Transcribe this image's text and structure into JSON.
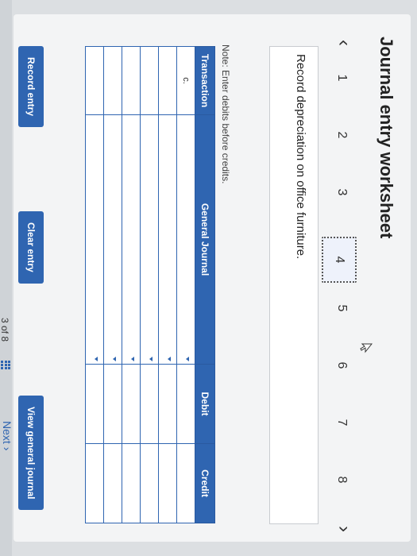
{
  "title": "Journal entry worksheet",
  "steps": [
    "1",
    "2",
    "3",
    "4",
    "5",
    "6",
    "7",
    "8"
  ],
  "active_step": "4",
  "prompt": "Record depreciation on office furniture.",
  "note": "Note: Enter debits before credits.",
  "table": {
    "headers": {
      "transaction": "Transaction",
      "general_journal": "General Journal",
      "debit": "Debit",
      "credit": "Credit"
    },
    "rows": [
      {
        "transaction": "c."
      },
      {
        "transaction": ""
      },
      {
        "transaction": ""
      },
      {
        "transaction": ""
      },
      {
        "transaction": ""
      },
      {
        "transaction": ""
      }
    ]
  },
  "buttons": {
    "record": "Record entry",
    "clear": "Clear entry",
    "view": "View general journal"
  },
  "pager": {
    "text": "3 of 8"
  },
  "next_label": "Next",
  "colors": {
    "accent": "#2f65b1",
    "panel": "#f3f4f5"
  }
}
